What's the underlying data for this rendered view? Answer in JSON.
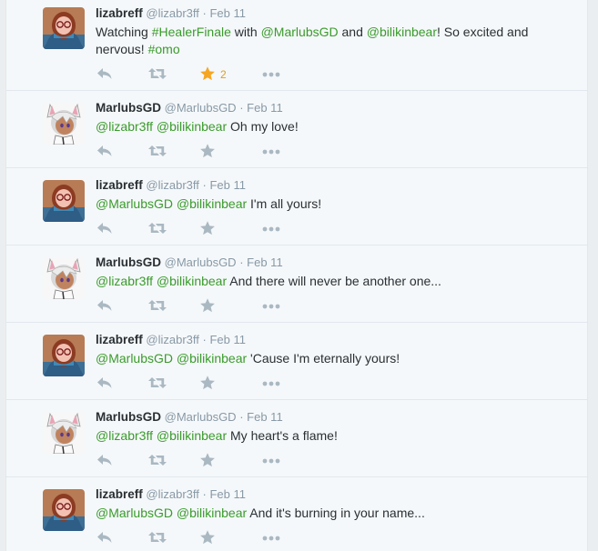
{
  "tweets": [
    {
      "user": "liza",
      "name": "lizabreff",
      "handle": "@lizabr3ff",
      "sep": "·",
      "date": "Feb 11",
      "text": [
        {
          "t": "Watching ",
          "hl": false
        },
        {
          "t": "#HealerFinale",
          "hl": true
        },
        {
          "t": " with ",
          "hl": false
        },
        {
          "t": "@MarlubsGD",
          "hl": true
        },
        {
          "t": " and ",
          "hl": false
        },
        {
          "t": "@bilikinbear",
          "hl": true
        },
        {
          "t": "! So excited and nervous! ",
          "hl": false
        },
        {
          "t": "#omo",
          "hl": true
        }
      ],
      "favorited": true,
      "fav_count": "2"
    },
    {
      "user": "marlubs",
      "name": "MarlubsGD",
      "handle": "@MarlubsGD",
      "sep": "·",
      "date": "Feb 11",
      "text": [
        {
          "t": "@lizabr3ff",
          "hl": true
        },
        {
          "t": " ",
          "hl": false
        },
        {
          "t": "@bilikinbear",
          "hl": true
        },
        {
          "t": " Oh my love!",
          "hl": false
        }
      ],
      "favorited": false,
      "fav_count": ""
    },
    {
      "user": "liza",
      "name": "lizabreff",
      "handle": "@lizabr3ff",
      "sep": "·",
      "date": "Feb 11",
      "text": [
        {
          "t": "@MarlubsGD",
          "hl": true
        },
        {
          "t": " ",
          "hl": false
        },
        {
          "t": "@bilikinbear",
          "hl": true
        },
        {
          "t": " I'm all yours!",
          "hl": false
        }
      ],
      "favorited": false,
      "fav_count": ""
    },
    {
      "user": "marlubs",
      "name": "MarlubsGD",
      "handle": "@MarlubsGD",
      "sep": "·",
      "date": "Feb 11",
      "text": [
        {
          "t": "@lizabr3ff",
          "hl": true
        },
        {
          "t": " ",
          "hl": false
        },
        {
          "t": "@bilikinbear",
          "hl": true
        },
        {
          "t": " And there will never be another one...",
          "hl": false
        }
      ],
      "favorited": false,
      "fav_count": ""
    },
    {
      "user": "liza",
      "name": "lizabreff",
      "handle": "@lizabr3ff",
      "sep": "·",
      "date": "Feb 11",
      "text": [
        {
          "t": "@MarlubsGD",
          "hl": true
        },
        {
          "t": " ",
          "hl": false
        },
        {
          "t": "@bilikinbear",
          "hl": true
        },
        {
          "t": " 'Cause I'm eternally yours!",
          "hl": false
        }
      ],
      "favorited": false,
      "fav_count": ""
    },
    {
      "user": "marlubs",
      "name": "MarlubsGD",
      "handle": "@MarlubsGD",
      "sep": "·",
      "date": "Feb 11",
      "text": [
        {
          "t": "@lizabr3ff",
          "hl": true
        },
        {
          "t": " ",
          "hl": false
        },
        {
          "t": "@bilikinbear",
          "hl": true
        },
        {
          "t": " My heart's a flame!",
          "hl": false
        }
      ],
      "favorited": false,
      "fav_count": ""
    },
    {
      "user": "liza",
      "name": "lizabreff",
      "handle": "@lizabr3ff",
      "sep": "·",
      "date": "Feb 11",
      "text": [
        {
          "t": "@MarlubsGD",
          "hl": true
        },
        {
          "t": " ",
          "hl": false
        },
        {
          "t": "@bilikinbear",
          "hl": true
        },
        {
          "t": " And it's burning in your name...",
          "hl": false
        }
      ],
      "favorited": false,
      "fav_count": ""
    }
  ],
  "icons": {
    "reply": "reply-icon",
    "retweet": "retweet-icon",
    "favorite": "star-icon",
    "more": "more-icon"
  },
  "colors": {
    "link": "#3a9b2c",
    "favorite_active": "#f5a623",
    "icon_idle": "#aab8c2"
  }
}
